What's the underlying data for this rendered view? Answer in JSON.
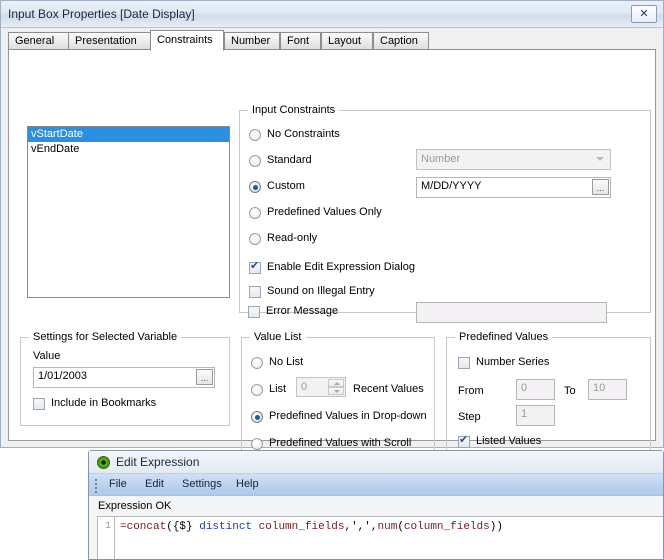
{
  "window": {
    "title": "Input Box Properties [Date Display]",
    "close_label": "✕",
    "close_icon": "close-icon"
  },
  "tabs": [
    {
      "label": "General",
      "active": false
    },
    {
      "label": "Presentation",
      "active": false
    },
    {
      "label": "Constraints",
      "active": true
    },
    {
      "label": "Number",
      "active": false
    },
    {
      "label": "Font",
      "active": false
    },
    {
      "label": "Layout",
      "active": false
    },
    {
      "label": "Caption",
      "active": false
    }
  ],
  "variable_list": {
    "items": [
      {
        "label": "vStartDate",
        "selected": true
      },
      {
        "label": "vEndDate",
        "selected": false
      }
    ]
  },
  "input_constraints": {
    "legend": "Input Constraints",
    "radios": [
      {
        "label": "No Constraints",
        "checked": false
      },
      {
        "label": "Standard",
        "checked": false
      },
      {
        "label": "Custom",
        "checked": true
      },
      {
        "label": "Predefined Values Only",
        "checked": false
      },
      {
        "label": "Read-only",
        "checked": false
      }
    ],
    "standard_combo": {
      "value": "Number"
    },
    "custom_field": {
      "value": "M/DD/YYYY",
      "button_label": "..."
    },
    "checkboxes": [
      {
        "label": "Enable Edit Expression Dialog",
        "checked": true
      },
      {
        "label": "Sound on Illegal Entry",
        "checked": false
      },
      {
        "label": "Error Message",
        "checked": false
      }
    ],
    "error_message_value": ""
  },
  "settings_for_selected_variable": {
    "legend": "Settings for Selected Variable",
    "value_label": "Value",
    "value": "1/01/2003",
    "value_button_label": "...",
    "include_in_bookmarks": {
      "label": "Include in Bookmarks",
      "checked": false
    }
  },
  "value_list": {
    "legend": "Value List",
    "radios": [
      {
        "label": "No List",
        "checked": false
      },
      {
        "label": "List",
        "checked": false
      },
      {
        "label": "Predefined Values in Drop-down",
        "checked": true
      },
      {
        "label": "Predefined Values with Scroll",
        "checked": false
      }
    ],
    "recent_count": "0",
    "recent_values_label": "Recent Values"
  },
  "predefined_values": {
    "legend": "Predefined Values",
    "number_series": {
      "label": "Number Series",
      "checked": false
    },
    "from_label": "From",
    "from_value": "0",
    "to_label": "To",
    "to_value": "10",
    "step_label": "Step",
    "step_value": "1",
    "listed_values": {
      "label": "Listed Values",
      "checked": true
    },
    "listed_expression_visible": "=concat({$} distinct column_f",
    "expression_button_label": "..."
  },
  "edit_expression": {
    "title": "Edit Expression",
    "app_icon": "qlikview-icon",
    "menu": [
      {
        "label": "File"
      },
      {
        "label": "Edit"
      },
      {
        "label": "Settings"
      },
      {
        "label": "Help"
      }
    ],
    "status": "Expression OK",
    "line_number": "1",
    "expression_tokens": [
      {
        "text": "=concat",
        "kind": "fn"
      },
      {
        "text": "({$} ",
        "kind": "pl"
      },
      {
        "text": "distinct",
        "kind": "kw"
      },
      {
        "text": " ",
        "kind": "pl"
      },
      {
        "text": "column_fields",
        "kind": "id"
      },
      {
        "text": ",',',",
        "kind": "pl"
      },
      {
        "text": "num",
        "kind": "id"
      },
      {
        "text": "(",
        "kind": "pl"
      },
      {
        "text": "column_fields",
        "kind": "id"
      },
      {
        "text": "))",
        "kind": "pl"
      }
    ],
    "expression_text": "=concat({$} distinct column_fields,',',num(column_fields))"
  },
  "colors": {
    "selection_blue": "#2a8fe0",
    "radio_dot": "#15619e",
    "check_blue": "#1f4f8f",
    "titlebar": "#dfe9f4",
    "menubar_blue": "#bdd4ef",
    "token_function": "#7b1b1b",
    "token_keyword": "#1b39b8",
    "hot_button": "#8ec5ef"
  }
}
